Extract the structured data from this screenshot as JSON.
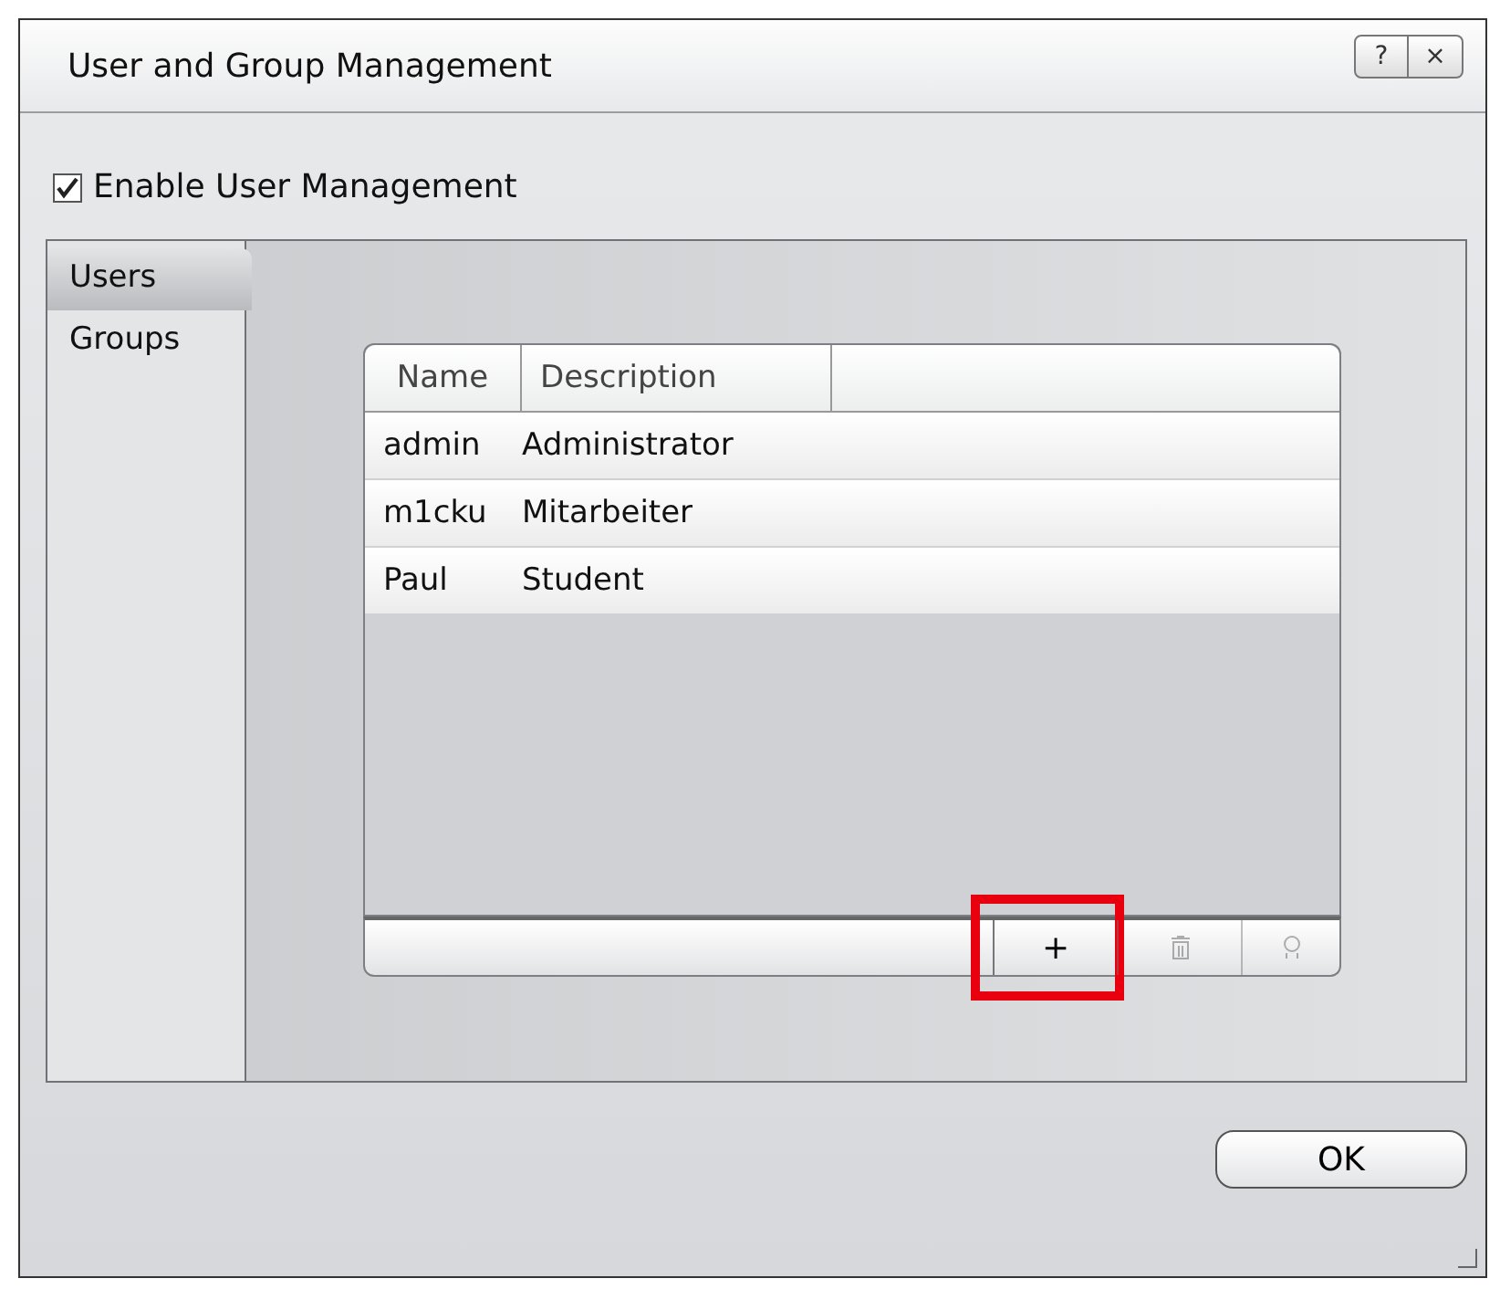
{
  "window": {
    "title": "User and Group Management",
    "title_buttons": [
      "?",
      "×"
    ]
  },
  "enable_checkbox": {
    "label": "Enable User Management",
    "checked": true
  },
  "tabs": [
    {
      "label": "Users",
      "selected": true
    },
    {
      "label": "Groups",
      "selected": false
    }
  ],
  "table": {
    "columns": [
      "Name",
      "Description"
    ],
    "rows": [
      {
        "name": "admin",
        "description": "Administrator"
      },
      {
        "name": "m1cku",
        "description": "Mitarbeiter"
      },
      {
        "name": "Paul",
        "description": "Student"
      }
    ]
  },
  "toolbar": [
    {
      "kind": "add",
      "label": "+",
      "disabled": false,
      "highlighted": true
    },
    {
      "kind": "delete",
      "disabled": true,
      "highlighted": false
    },
    {
      "kind": "user",
      "disabled": true,
      "highlighted": false
    }
  ],
  "buttons": [
    "OK"
  ]
}
